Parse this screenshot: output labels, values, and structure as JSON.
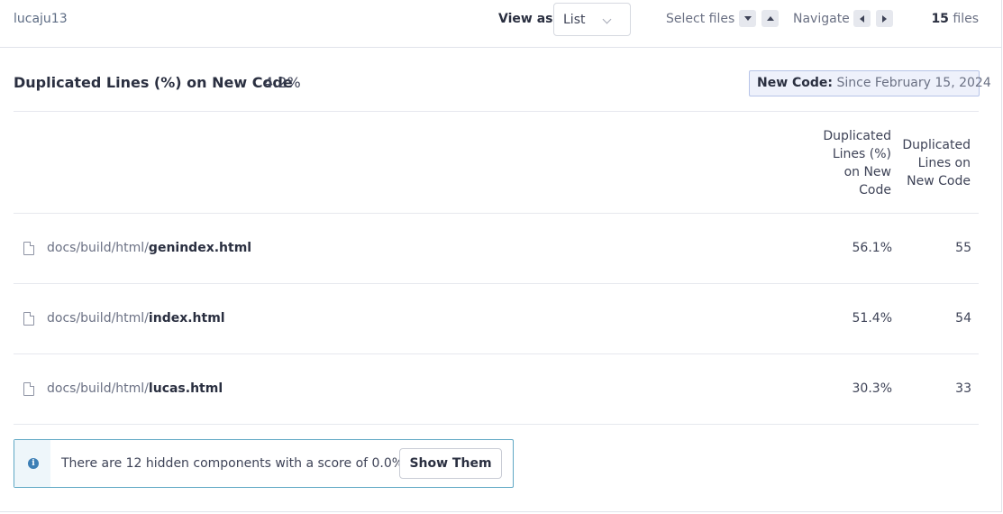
{
  "topbar": {
    "breadcrumb": "lucaju13",
    "view_as_label": "View as",
    "view_as_value": "List",
    "select_files_label": "Select files",
    "navigate_label": "Navigate",
    "files_count": "15",
    "files_word": "files"
  },
  "measure": {
    "title": "Duplicated Lines (%) on New Code",
    "value": "4.2%",
    "new_code_key": "New Code:",
    "new_code_value": "Since February 15, 2024"
  },
  "table": {
    "columns": [
      [
        "Duplicated",
        "Lines (%)",
        "on New",
        "Code"
      ],
      [
        "Duplicated",
        "Lines on",
        "New Code"
      ]
    ],
    "rows": [
      {
        "dir": "docs/build/html/",
        "file": "genindex.html",
        "pct": "56.1%",
        "lines": "55"
      },
      {
        "dir": "docs/build/html/",
        "file": "index.html",
        "pct": "51.4%",
        "lines": "54"
      },
      {
        "dir": "docs/build/html/",
        "file": "lucas.html",
        "pct": "30.3%",
        "lines": "33"
      }
    ]
  },
  "alert": {
    "message": "There are 12 hidden components with a score of 0.0%.",
    "button": "Show Them"
  }
}
